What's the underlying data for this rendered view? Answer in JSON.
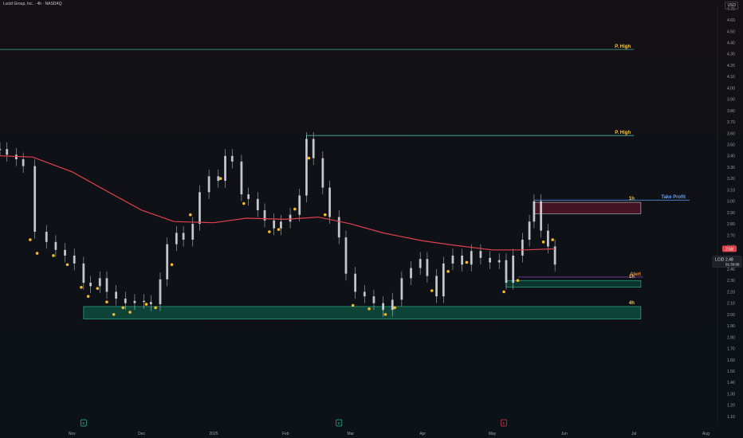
{
  "header": {
    "title": "Lucid Group, Inc. · 4h · NASDAQ",
    "currency": "USD"
  },
  "colors": {
    "background": "#0f1013",
    "axis_text": "#9aa0a6",
    "candle": "#d9dde3",
    "ma": "#e0424c",
    "dot": "#f5b92e",
    "green_zone": "#0d4a3b",
    "green_border": "#2fbf96",
    "red_zone": "#4a1426",
    "level_line": "#4fd1b0",
    "label_yellow": "#f5c842",
    "take_profit": "#5ea1ff",
    "alert": "#f08a3c",
    "alert_line": "#b04bd6",
    "price_badge": "#e0424c"
  },
  "chart_data": {
    "type": "line",
    "title": "Lucid Group, Inc. · 4h · NASDAQ",
    "xlabel": "",
    "ylabel": "",
    "ylim": [
      1.05,
      4.72
    ],
    "xlim": [
      "2024-10-01",
      "2025-08-06"
    ],
    "grid": false,
    "y_ticks": [
      "4.70",
      "4.60",
      "4.50",
      "4.40",
      "4.30",
      "4.20",
      "4.10",
      "4.00",
      "3.90",
      "3.80",
      "3.70",
      "3.60",
      "3.50",
      "3.40",
      "3.30",
      "3.20",
      "3.10",
      "3.00",
      "2.90",
      "2.80",
      "2.70",
      "2.60",
      "2.50",
      "2.40",
      "2.30",
      "2.20",
      "2.10",
      "2.00",
      "1.90",
      "1.80",
      "1.70",
      "1.60",
      "1.50",
      "1.40",
      "1.30",
      "1.20",
      "1.10"
    ],
    "x_ticks": [
      {
        "label": "Nov",
        "date": "2024-11-01"
      },
      {
        "label": "Dec",
        "date": "2024-12-01"
      },
      {
        "label": "2025",
        "date": "2025-01-01"
      },
      {
        "label": "Feb",
        "date": "2025-02-01"
      },
      {
        "label": "Mar",
        "date": "2025-03-01"
      },
      {
        "label": "Apr",
        "date": "2025-04-01"
      },
      {
        "label": "May",
        "date": "2025-05-01"
      },
      {
        "label": "Jun",
        "date": "2025-06-01"
      },
      {
        "label": "Jul",
        "date": "2025-07-01"
      },
      {
        "label": "Aug",
        "date": "2025-08-01"
      }
    ],
    "series": [
      {
        "type": "candles",
        "points": [
          {
            "x": "2024-10-01",
            "c": 3.46
          },
          {
            "x": "2024-10-04",
            "c": 3.41
          },
          {
            "x": "2024-10-08",
            "c": 3.37
          },
          {
            "x": "2024-10-11",
            "c": 3.31
          },
          {
            "x": "2024-10-16",
            "c": 2.73
          },
          {
            "x": "2024-10-21",
            "c": 2.64
          },
          {
            "x": "2024-10-25",
            "c": 2.57
          },
          {
            "x": "2024-10-29",
            "c": 2.52
          },
          {
            "x": "2024-11-02",
            "c": 2.45
          },
          {
            "x": "2024-11-06",
            "c": 2.28
          },
          {
            "x": "2024-11-09",
            "c": 2.25
          },
          {
            "x": "2024-11-13",
            "c": 2.32
          },
          {
            "x": "2024-11-16",
            "c": 2.2
          },
          {
            "x": "2024-11-20",
            "c": 2.14
          },
          {
            "x": "2024-11-24",
            "c": 2.1
          },
          {
            "x": "2024-11-28",
            "c": 2.12
          },
          {
            "x": "2024-12-02",
            "c": 2.11
          },
          {
            "x": "2024-12-05",
            "c": 2.09
          },
          {
            "x": "2024-12-09",
            "c": 2.31
          },
          {
            "x": "2024-12-12",
            "c": 2.62
          },
          {
            "x": "2024-12-16",
            "c": 2.72
          },
          {
            "x": "2024-12-19",
            "c": 2.66
          },
          {
            "x": "2024-12-23",
            "c": 2.8
          },
          {
            "x": "2024-12-26",
            "c": 3.08
          },
          {
            "x": "2024-12-30",
            "c": 3.22
          },
          {
            "x": "2025-01-03",
            "c": 3.18
          },
          {
            "x": "2025-01-06",
            "c": 3.4
          },
          {
            "x": "2025-01-09",
            "c": 3.35
          },
          {
            "x": "2025-01-13",
            "c": 3.06
          },
          {
            "x": "2025-01-16",
            "c": 3.02
          },
          {
            "x": "2025-01-20",
            "c": 2.92
          },
          {
            "x": "2025-01-23",
            "c": 2.83
          },
          {
            "x": "2025-01-27",
            "c": 2.76
          },
          {
            "x": "2025-01-30",
            "c": 2.82
          },
          {
            "x": "2025-02-03",
            "c": 2.88
          },
          {
            "x": "2025-02-07",
            "c": 3.05
          },
          {
            "x": "2025-02-10",
            "c": 3.55
          },
          {
            "x": "2025-02-13",
            "c": 3.38
          },
          {
            "x": "2025-02-17",
            "c": 3.12
          },
          {
            "x": "2025-02-20",
            "c": 2.86
          },
          {
            "x": "2025-02-24",
            "c": 2.68
          },
          {
            "x": "2025-02-27",
            "c": 2.36
          },
          {
            "x": "2025-03-03",
            "c": 2.2
          },
          {
            "x": "2025-03-07",
            "c": 2.16
          },
          {
            "x": "2025-03-11",
            "c": 2.1
          },
          {
            "x": "2025-03-15",
            "c": 2.04
          },
          {
            "x": "2025-03-19",
            "c": 2.13
          },
          {
            "x": "2025-03-23",
            "c": 2.32
          },
          {
            "x": "2025-03-27",
            "c": 2.41
          },
          {
            "x": "2025-03-31",
            "c": 2.49
          },
          {
            "x": "2025-04-03",
            "c": 2.34
          },
          {
            "x": "2025-04-07",
            "c": 2.16
          },
          {
            "x": "2025-04-10",
            "c": 2.45
          },
          {
            "x": "2025-04-14",
            "c": 2.52
          },
          {
            "x": "2025-04-18",
            "c": 2.44
          },
          {
            "x": "2025-04-22",
            "c": 2.56
          },
          {
            "x": "2025-04-26",
            "c": 2.5
          },
          {
            "x": "2025-04-30",
            "c": 2.46
          },
          {
            "x": "2025-05-04",
            "c": 2.48
          },
          {
            "x": "2025-05-07",
            "c": 2.28
          },
          {
            "x": "2025-05-10",
            "c": 2.52
          },
          {
            "x": "2025-05-14",
            "c": 2.66
          },
          {
            "x": "2025-05-17",
            "c": 2.82
          },
          {
            "x": "2025-05-19",
            "c": 3.0
          },
          {
            "x": "2025-05-22",
            "c": 2.74
          },
          {
            "x": "2025-05-25",
            "c": 2.6
          },
          {
            "x": "2025-05-28",
            "c": 2.44
          }
        ]
      },
      {
        "type": "ma",
        "points": [
          {
            "x": "2024-10-01",
            "y": 3.4
          },
          {
            "x": "2024-10-15",
            "y": 3.39
          },
          {
            "x": "2024-11-01",
            "y": 3.26
          },
          {
            "x": "2024-11-15",
            "y": 3.1
          },
          {
            "x": "2024-12-01",
            "y": 2.92
          },
          {
            "x": "2024-12-15",
            "y": 2.82
          },
          {
            "x": "2025-01-01",
            "y": 2.81
          },
          {
            "x": "2025-01-15",
            "y": 2.85
          },
          {
            "x": "2025-02-01",
            "y": 2.84
          },
          {
            "x": "2025-02-15",
            "y": 2.86
          },
          {
            "x": "2025-03-01",
            "y": 2.8
          },
          {
            "x": "2025-03-15",
            "y": 2.72
          },
          {
            "x": "2025-04-01",
            "y": 2.65
          },
          {
            "x": "2025-04-15",
            "y": 2.61
          },
          {
            "x": "2025-05-01",
            "y": 2.57
          },
          {
            "x": "2025-05-15",
            "y": 2.57
          },
          {
            "x": "2025-05-28",
            "y": 2.58
          }
        ]
      },
      {
        "type": "signals",
        "points": [
          {
            "x": "2024-10-14",
            "y": 2.66
          },
          {
            "x": "2024-10-17",
            "y": 2.54
          },
          {
            "x": "2024-10-24",
            "y": 2.52
          },
          {
            "x": "2024-10-30",
            "y": 2.44
          },
          {
            "x": "2024-11-05",
            "y": 2.24
          },
          {
            "x": "2024-11-08",
            "y": 2.16
          },
          {
            "x": "2024-11-12",
            "y": 2.23
          },
          {
            "x": "2024-11-16",
            "y": 2.11
          },
          {
            "x": "2024-11-19",
            "y": 2.0
          },
          {
            "x": "2024-11-23",
            "y": 2.06
          },
          {
            "x": "2024-11-26",
            "y": 2.02
          },
          {
            "x": "2024-12-03",
            "y": 2.09
          },
          {
            "x": "2024-12-07",
            "y": 2.06
          },
          {
            "x": "2024-12-14",
            "y": 2.44
          },
          {
            "x": "2024-12-22",
            "y": 2.88
          },
          {
            "x": "2025-01-04",
            "y": 3.2
          },
          {
            "x": "2025-01-14",
            "y": 2.98
          },
          {
            "x": "2025-01-25",
            "y": 2.73
          },
          {
            "x": "2025-01-29",
            "y": 2.75
          },
          {
            "x": "2025-02-05",
            "y": 2.93
          },
          {
            "x": "2025-02-11",
            "y": 3.38
          },
          {
            "x": "2025-02-18",
            "y": 2.88
          },
          {
            "x": "2025-03-02",
            "y": 2.08
          },
          {
            "x": "2025-03-09",
            "y": 2.05
          },
          {
            "x": "2025-03-16",
            "y": 2.0
          },
          {
            "x": "2025-03-20",
            "y": 2.06
          },
          {
            "x": "2025-04-05",
            "y": 2.21
          },
          {
            "x": "2025-04-12",
            "y": 2.38
          },
          {
            "x": "2025-04-20",
            "y": 2.46
          },
          {
            "x": "2025-05-06",
            "y": 2.2
          },
          {
            "x": "2025-05-12",
            "y": 2.3
          },
          {
            "x": "2025-05-23",
            "y": 2.64
          },
          {
            "x": "2025-05-27",
            "y": 2.66
          }
        ]
      }
    ],
    "annotations": [
      {
        "kind": "level_line",
        "label": "P. High",
        "y": 4.34,
        "x_from": "2024-10-01",
        "x_to": "2025-07-01"
      },
      {
        "kind": "level_line",
        "label": "P. High",
        "y": 3.58,
        "x_from": "2025-02-10",
        "x_to": "2025-07-01"
      },
      {
        "kind": "zone",
        "label": "4h",
        "y_low": 1.96,
        "y_high": 2.07,
        "x_from": "2024-11-06",
        "x_to": "2025-07-04",
        "color": "#0d4a3b"
      },
      {
        "kind": "zone",
        "label": "1h",
        "y_low": 2.89,
        "y_high": 2.99,
        "x_from": "2025-05-19",
        "x_to": "2025-07-04",
        "color": "#4a1426"
      },
      {
        "kind": "zone",
        "label": "1h",
        "y_low": 2.24,
        "y_high": 2.3,
        "x_from": "2025-05-07",
        "x_to": "2025-07-04",
        "color": "#0a3a30"
      },
      {
        "kind": "line",
        "label": "Take Profit",
        "y": 3.01,
        "x_from": "2025-05-19",
        "x_to": "2025-07-25",
        "color": "#5ea1ff"
      },
      {
        "kind": "line",
        "label": "Alert",
        "y": 2.33,
        "x_from": "2025-05-12",
        "x_to": "2025-07-05",
        "color": "#b04bd6"
      }
    ],
    "price_tags": [
      {
        "label": "2.58",
        "y": 2.58
      },
      {
        "label": "LCID",
        "value": "2.48",
        "countdown": "01:30:06",
        "y": 2.48
      }
    ],
    "event_markers": [
      {
        "glyph": "E",
        "date": "2024-11-06"
      },
      {
        "glyph": "E",
        "date": "2025-02-24"
      },
      {
        "glyph": "E",
        "date": "2025-05-06"
      }
    ]
  }
}
